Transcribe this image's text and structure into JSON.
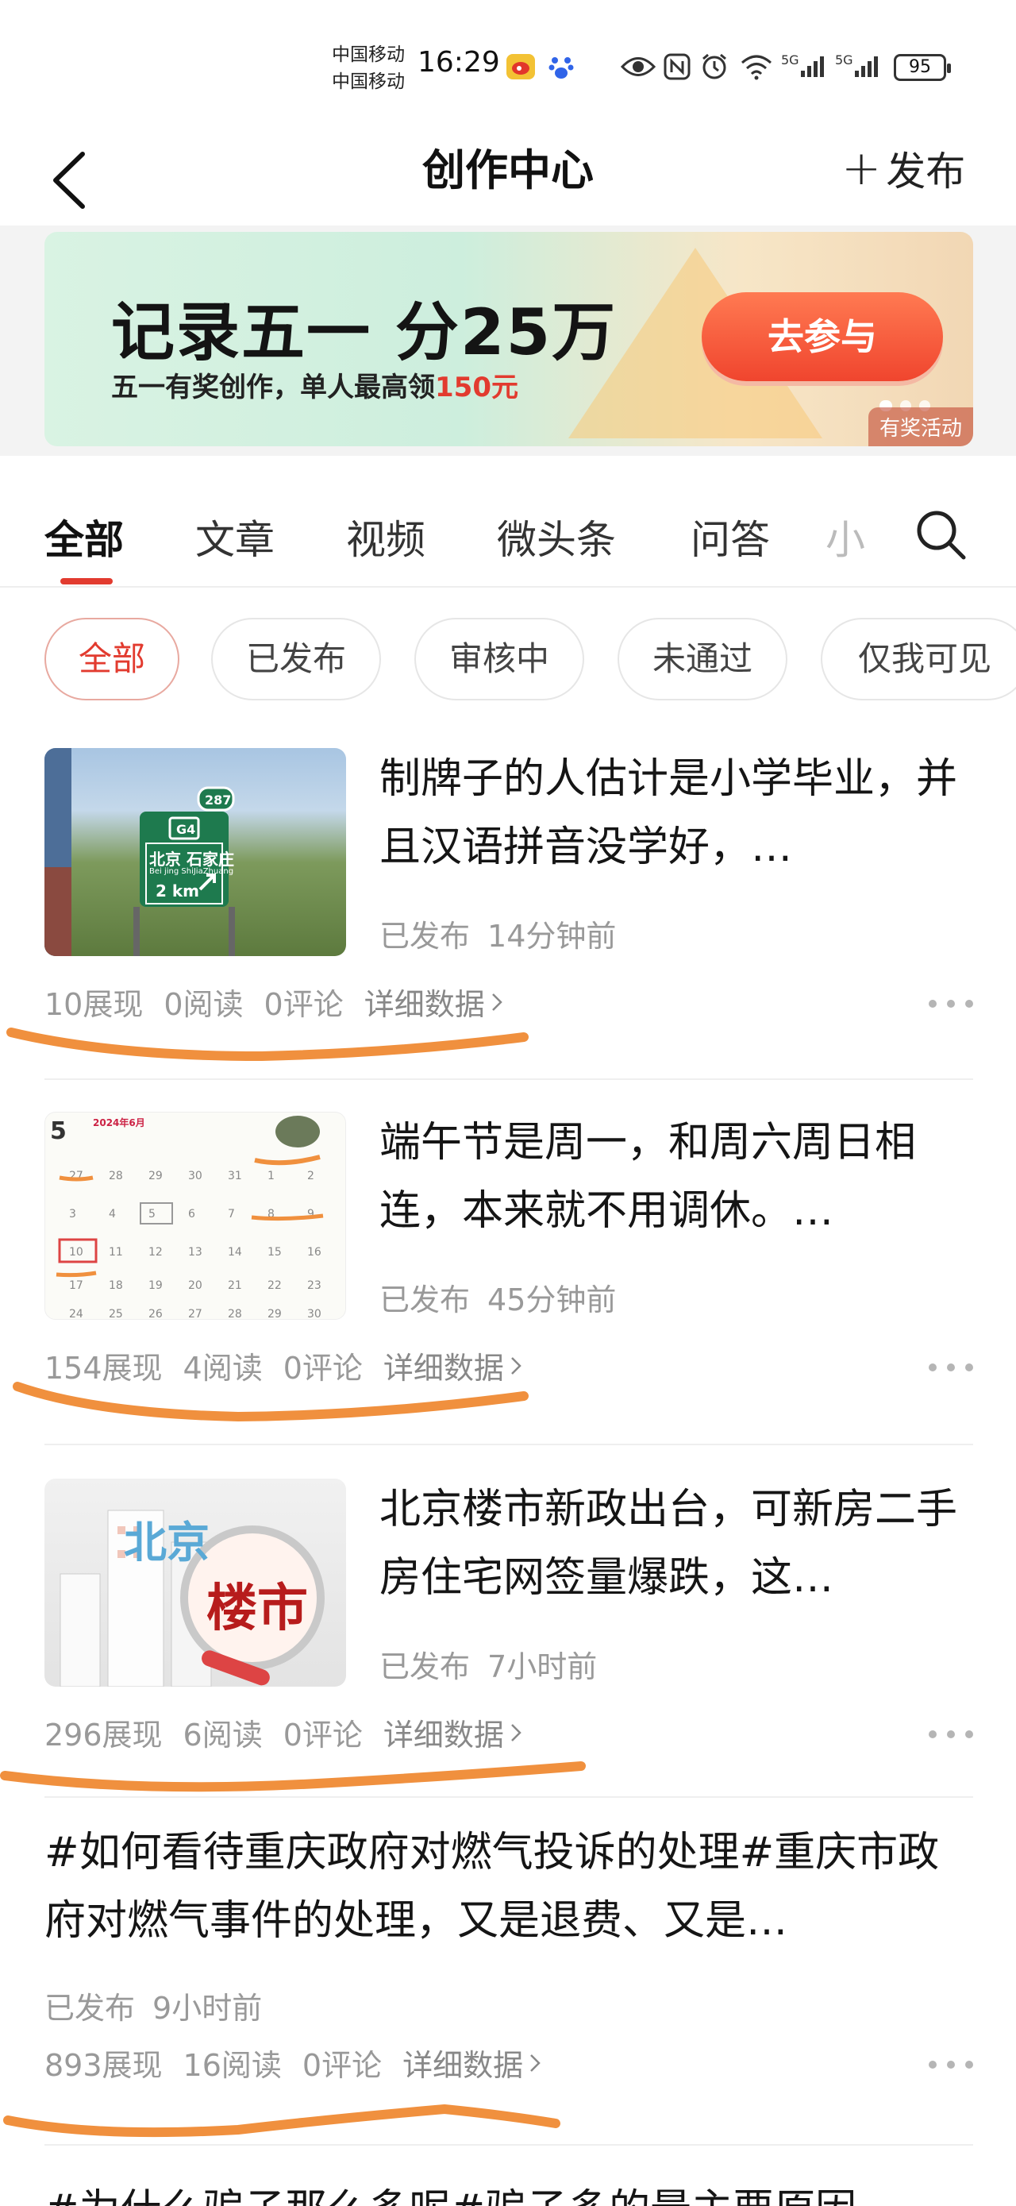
{
  "status_bar": {
    "carrier_1": "中国移动",
    "carrier_2": "中国移动",
    "time": "16:29",
    "battery": "95",
    "signal_1": "5G",
    "signal_2": "5G",
    "icons": [
      "weibo-icon",
      "baidu-paw-icon",
      "eye-icon",
      "nfc-icon",
      "alarm-icon",
      "wifi-icon",
      "signal-icon",
      "signal-icon"
    ]
  },
  "nav": {
    "title": "创作中心",
    "publish_label": "发布",
    "publish_plus": "+",
    "back_icon": "chevron-left-icon"
  },
  "banner": {
    "title": "记录五一 分25万",
    "subtitle_prefix": "五一有奖创作，单人最高领",
    "subtitle_highlight": "150元",
    "cta_label": "去参与",
    "tag": "有奖活动",
    "page_count": 3,
    "active_page": 1,
    "colors": {
      "cta": "#f0452e",
      "highlight": "#e23b2f"
    }
  },
  "tabs": {
    "items": [
      "全部",
      "文章",
      "视频",
      "微头条",
      "问答"
    ],
    "faded_item": "小",
    "active_index": 0,
    "search_icon": "search-icon",
    "accent": "#e23b2f"
  },
  "filters": {
    "items": [
      "全部",
      "已发布",
      "审核中",
      "未通过",
      "仅我可见"
    ],
    "active_index": 0
  },
  "posts": [
    {
      "title": "制牌子的人估计是小学毕业，并且汉语拼音没学好，…",
      "status": "已发布",
      "time": "14分钟前",
      "views": "10展现",
      "reads": "0阅读",
      "comments": "0评论",
      "detail": "详细数据",
      "thumb": {
        "sign_route": "G4",
        "sign_number": "287",
        "sign_cn": "北京  石家庄",
        "sign_py": "Bei jing  ShiJiaZhuang",
        "sign_dist": "2 km"
      }
    },
    {
      "title": "端午节是周一，和周六周日相连，本来就不用调休。…",
      "status": "已发布",
      "time": "45分钟前",
      "views": "154展现",
      "reads": "4阅读",
      "comments": "0评论",
      "detail": "详细数据",
      "thumb": {
        "cal_day": "5",
        "cal_month": "2024年6月"
      }
    },
    {
      "title": "北京楼市新政出台，可新房二手房住宅网签量爆跌，这…",
      "status": "已发布",
      "time": "7小时前",
      "views": "296展现",
      "reads": "6阅读",
      "comments": "0评论",
      "detail": "详细数据",
      "thumb": {
        "text_1": "北京",
        "text_2": "楼市"
      }
    },
    {
      "title": "#如何看待重庆政府对燃气投诉的处理#重庆市政府对燃气事件的处理，又是退费、又是…",
      "status": "已发布",
      "time": "9小时前",
      "views": "893展现",
      "reads": "16阅读",
      "comments": "0评论",
      "detail": "详细数据"
    }
  ],
  "next_post_title": "#为什么骗子那么多呢#骗子多的最主要原因",
  "colors": {
    "scribble": "#f0903e",
    "meta": "#999999"
  }
}
